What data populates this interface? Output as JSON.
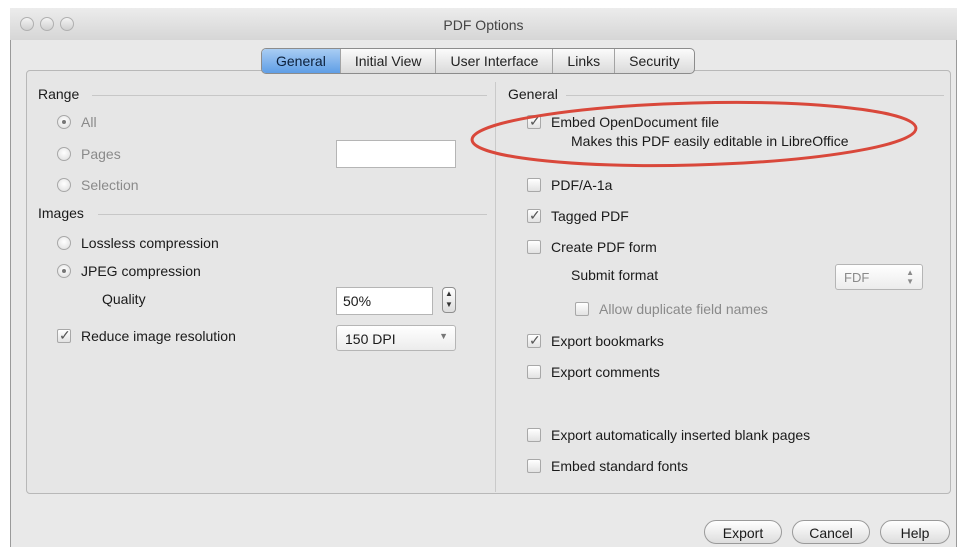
{
  "window": {
    "title": "PDF Options"
  },
  "tabs": [
    {
      "label": "General"
    },
    {
      "label": "Initial View"
    },
    {
      "label": "User Interface"
    },
    {
      "label": "Links"
    },
    {
      "label": "Security"
    }
  ],
  "left": {
    "range": {
      "heading": "Range",
      "all": "All",
      "pages": "Pages",
      "pages_value": "",
      "selection": "Selection"
    },
    "images": {
      "heading": "Images",
      "lossless": "Lossless compression",
      "jpeg": "JPEG compression",
      "quality_label": "Quality",
      "quality_value": "50%",
      "reduce": "Reduce image resolution",
      "resolution_value": "150 DPI"
    }
  },
  "right": {
    "heading": "General",
    "embed_odf": "Embed OpenDocument file",
    "embed_odf_desc": "Makes this PDF easily editable in LibreOffice",
    "pdfa": "PDF/A-1a",
    "tagged": "Tagged PDF",
    "create_form": "Create PDF form",
    "submit_format_label": "Submit format",
    "submit_format_value": "FDF",
    "allow_dup": "Allow duplicate field names",
    "export_bookmarks": "Export bookmarks",
    "export_comments": "Export comments",
    "export_blank": "Export automatically inserted blank pages",
    "embed_std_fonts": "Embed standard fonts"
  },
  "footer": {
    "export": "Export",
    "cancel": "Cancel",
    "help": "Help"
  },
  "colors": {
    "annotation": "#d9483b",
    "tab_active": "#6aa6e8"
  }
}
